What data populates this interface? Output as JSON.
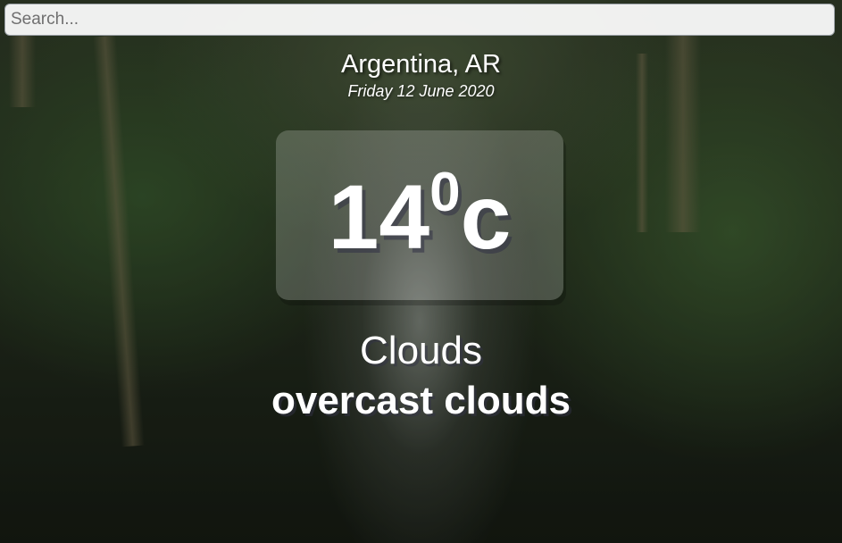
{
  "search": {
    "placeholder": "Search...",
    "value": ""
  },
  "location": {
    "city_country": "Argentina, AR",
    "date": "Friday 12 June 2020"
  },
  "temperature": {
    "value": "14",
    "degree": "0",
    "unit": "c"
  },
  "weather": {
    "main": "Clouds",
    "description": "overcast clouds"
  },
  "colors": {
    "text": "#ffffff",
    "temp_box": "rgba(255,255,255,0.2)"
  }
}
